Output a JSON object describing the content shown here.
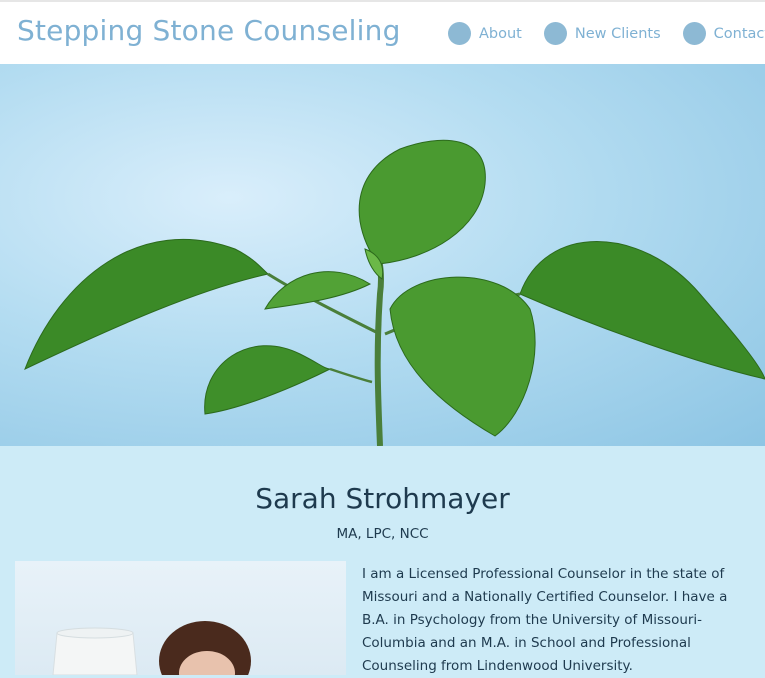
{
  "header": {
    "site_title": "Stepping Stone Counseling",
    "nav": [
      {
        "label": "About",
        "icon": "circle-icon"
      },
      {
        "label": "New Clients",
        "icon": "circle-icon"
      },
      {
        "label": "Contact",
        "icon": "circle-icon"
      }
    ]
  },
  "hero": {
    "image": "green-seedling-plant-photo"
  },
  "profile": {
    "name": "Sarah Strohmayer",
    "credentials": "MA, LPC, NCC",
    "photo": "portrait-photo",
    "bio": "I am a Licensed Professional Counselor in the state of Missouri and a Nationally Certified Counselor. I have a B.A. in Psychology from the University of Missouri-Columbia and an M.A. in School and Professional Counseling from Lindenwood University."
  },
  "colors": {
    "title": "#7fb1d3",
    "nav_dot": "#8db9d4",
    "content_bg": "#cdebf7",
    "text": "#1e3a4e"
  }
}
